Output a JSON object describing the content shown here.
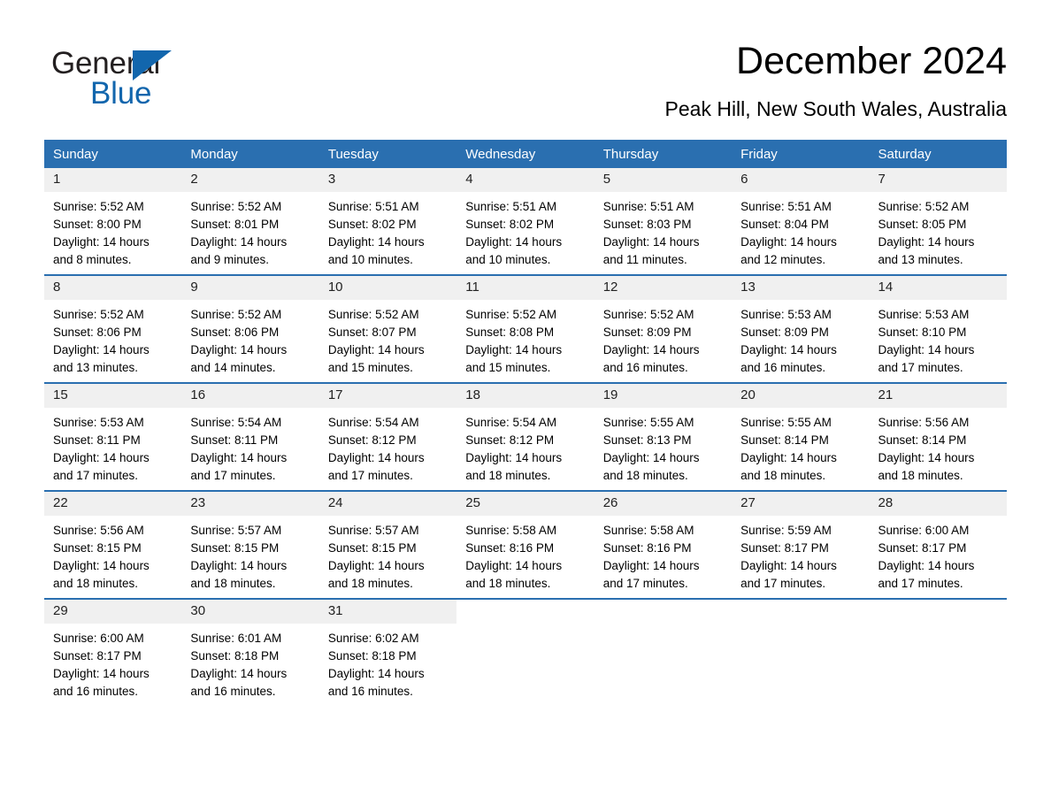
{
  "brand": {
    "name_part1": "General",
    "name_part2": "Blue",
    "accent_color": "#1266ad",
    "triangle_icon": "right-triangle-icon"
  },
  "header": {
    "month_title": "December 2024",
    "location": "Peak Hill, New South Wales, Australia"
  },
  "colors": {
    "header_blue": "#2a6fb0",
    "day_band_gray": "#f0f0f0",
    "text": "#000000"
  },
  "calendar": {
    "weekday_headers": [
      "Sunday",
      "Monday",
      "Tuesday",
      "Wednesday",
      "Thursday",
      "Friday",
      "Saturday"
    ],
    "weeks": [
      [
        {
          "day": "1",
          "sunrise": "Sunrise: 5:52 AM",
          "sunset": "Sunset: 8:00 PM",
          "daylight_line1": "Daylight: 14 hours",
          "daylight_line2": "and 8 minutes."
        },
        {
          "day": "2",
          "sunrise": "Sunrise: 5:52 AM",
          "sunset": "Sunset: 8:01 PM",
          "daylight_line1": "Daylight: 14 hours",
          "daylight_line2": "and 9 minutes."
        },
        {
          "day": "3",
          "sunrise": "Sunrise: 5:51 AM",
          "sunset": "Sunset: 8:02 PM",
          "daylight_line1": "Daylight: 14 hours",
          "daylight_line2": "and 10 minutes."
        },
        {
          "day": "4",
          "sunrise": "Sunrise: 5:51 AM",
          "sunset": "Sunset: 8:02 PM",
          "daylight_line1": "Daylight: 14 hours",
          "daylight_line2": "and 10 minutes."
        },
        {
          "day": "5",
          "sunrise": "Sunrise: 5:51 AM",
          "sunset": "Sunset: 8:03 PM",
          "daylight_line1": "Daylight: 14 hours",
          "daylight_line2": "and 11 minutes."
        },
        {
          "day": "6",
          "sunrise": "Sunrise: 5:51 AM",
          "sunset": "Sunset: 8:04 PM",
          "daylight_line1": "Daylight: 14 hours",
          "daylight_line2": "and 12 minutes."
        },
        {
          "day": "7",
          "sunrise": "Sunrise: 5:52 AM",
          "sunset": "Sunset: 8:05 PM",
          "daylight_line1": "Daylight: 14 hours",
          "daylight_line2": "and 13 minutes."
        }
      ],
      [
        {
          "day": "8",
          "sunrise": "Sunrise: 5:52 AM",
          "sunset": "Sunset: 8:06 PM",
          "daylight_line1": "Daylight: 14 hours",
          "daylight_line2": "and 13 minutes."
        },
        {
          "day": "9",
          "sunrise": "Sunrise: 5:52 AM",
          "sunset": "Sunset: 8:06 PM",
          "daylight_line1": "Daylight: 14 hours",
          "daylight_line2": "and 14 minutes."
        },
        {
          "day": "10",
          "sunrise": "Sunrise: 5:52 AM",
          "sunset": "Sunset: 8:07 PM",
          "daylight_line1": "Daylight: 14 hours",
          "daylight_line2": "and 15 minutes."
        },
        {
          "day": "11",
          "sunrise": "Sunrise: 5:52 AM",
          "sunset": "Sunset: 8:08 PM",
          "daylight_line1": "Daylight: 14 hours",
          "daylight_line2": "and 15 minutes."
        },
        {
          "day": "12",
          "sunrise": "Sunrise: 5:52 AM",
          "sunset": "Sunset: 8:09 PM",
          "daylight_line1": "Daylight: 14 hours",
          "daylight_line2": "and 16 minutes."
        },
        {
          "day": "13",
          "sunrise": "Sunrise: 5:53 AM",
          "sunset": "Sunset: 8:09 PM",
          "daylight_line1": "Daylight: 14 hours",
          "daylight_line2": "and 16 minutes."
        },
        {
          "day": "14",
          "sunrise": "Sunrise: 5:53 AM",
          "sunset": "Sunset: 8:10 PM",
          "daylight_line1": "Daylight: 14 hours",
          "daylight_line2": "and 17 minutes."
        }
      ],
      [
        {
          "day": "15",
          "sunrise": "Sunrise: 5:53 AM",
          "sunset": "Sunset: 8:11 PM",
          "daylight_line1": "Daylight: 14 hours",
          "daylight_line2": "and 17 minutes."
        },
        {
          "day": "16",
          "sunrise": "Sunrise: 5:54 AM",
          "sunset": "Sunset: 8:11 PM",
          "daylight_line1": "Daylight: 14 hours",
          "daylight_line2": "and 17 minutes."
        },
        {
          "day": "17",
          "sunrise": "Sunrise: 5:54 AM",
          "sunset": "Sunset: 8:12 PM",
          "daylight_line1": "Daylight: 14 hours",
          "daylight_line2": "and 17 minutes."
        },
        {
          "day": "18",
          "sunrise": "Sunrise: 5:54 AM",
          "sunset": "Sunset: 8:12 PM",
          "daylight_line1": "Daylight: 14 hours",
          "daylight_line2": "and 18 minutes."
        },
        {
          "day": "19",
          "sunrise": "Sunrise: 5:55 AM",
          "sunset": "Sunset: 8:13 PM",
          "daylight_line1": "Daylight: 14 hours",
          "daylight_line2": "and 18 minutes."
        },
        {
          "day": "20",
          "sunrise": "Sunrise: 5:55 AM",
          "sunset": "Sunset: 8:14 PM",
          "daylight_line1": "Daylight: 14 hours",
          "daylight_line2": "and 18 minutes."
        },
        {
          "day": "21",
          "sunrise": "Sunrise: 5:56 AM",
          "sunset": "Sunset: 8:14 PM",
          "daylight_line1": "Daylight: 14 hours",
          "daylight_line2": "and 18 minutes."
        }
      ],
      [
        {
          "day": "22",
          "sunrise": "Sunrise: 5:56 AM",
          "sunset": "Sunset: 8:15 PM",
          "daylight_line1": "Daylight: 14 hours",
          "daylight_line2": "and 18 minutes."
        },
        {
          "day": "23",
          "sunrise": "Sunrise: 5:57 AM",
          "sunset": "Sunset: 8:15 PM",
          "daylight_line1": "Daylight: 14 hours",
          "daylight_line2": "and 18 minutes."
        },
        {
          "day": "24",
          "sunrise": "Sunrise: 5:57 AM",
          "sunset": "Sunset: 8:15 PM",
          "daylight_line1": "Daylight: 14 hours",
          "daylight_line2": "and 18 minutes."
        },
        {
          "day": "25",
          "sunrise": "Sunrise: 5:58 AM",
          "sunset": "Sunset: 8:16 PM",
          "daylight_line1": "Daylight: 14 hours",
          "daylight_line2": "and 18 minutes."
        },
        {
          "day": "26",
          "sunrise": "Sunrise: 5:58 AM",
          "sunset": "Sunset: 8:16 PM",
          "daylight_line1": "Daylight: 14 hours",
          "daylight_line2": "and 17 minutes."
        },
        {
          "day": "27",
          "sunrise": "Sunrise: 5:59 AM",
          "sunset": "Sunset: 8:17 PM",
          "daylight_line1": "Daylight: 14 hours",
          "daylight_line2": "and 17 minutes."
        },
        {
          "day": "28",
          "sunrise": "Sunrise: 6:00 AM",
          "sunset": "Sunset: 8:17 PM",
          "daylight_line1": "Daylight: 14 hours",
          "daylight_line2": "and 17 minutes."
        }
      ],
      [
        {
          "day": "29",
          "sunrise": "Sunrise: 6:00 AM",
          "sunset": "Sunset: 8:17 PM",
          "daylight_line1": "Daylight: 14 hours",
          "daylight_line2": "and 16 minutes."
        },
        {
          "day": "30",
          "sunrise": "Sunrise: 6:01 AM",
          "sunset": "Sunset: 8:18 PM",
          "daylight_line1": "Daylight: 14 hours",
          "daylight_line2": "and 16 minutes."
        },
        {
          "day": "31",
          "sunrise": "Sunrise: 6:02 AM",
          "sunset": "Sunset: 8:18 PM",
          "daylight_line1": "Daylight: 14 hours",
          "daylight_line2": "and 16 minutes."
        },
        {
          "day": "",
          "sunrise": "",
          "sunset": "",
          "daylight_line1": "",
          "daylight_line2": ""
        },
        {
          "day": "",
          "sunrise": "",
          "sunset": "",
          "daylight_line1": "",
          "daylight_line2": ""
        },
        {
          "day": "",
          "sunrise": "",
          "sunset": "",
          "daylight_line1": "",
          "daylight_line2": ""
        },
        {
          "day": "",
          "sunrise": "",
          "sunset": "",
          "daylight_line1": "",
          "daylight_line2": ""
        }
      ]
    ]
  }
}
